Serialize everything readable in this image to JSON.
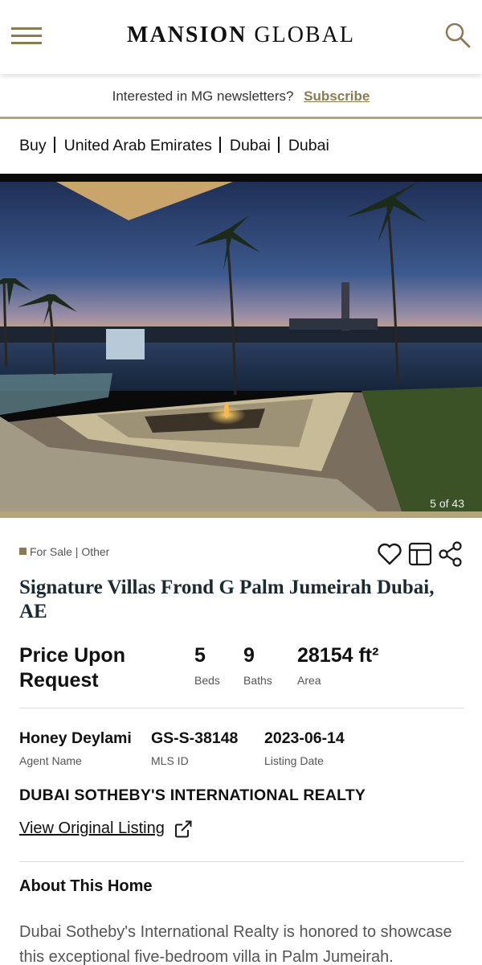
{
  "header": {
    "logo_bold": "MANSION",
    "logo_light": "GLOBAL",
    "menu_icon": "hamburger-menu-icon",
    "search_icon": "search-icon",
    "accent_color": "#8c7b52"
  },
  "newsletter": {
    "text": "Interested in MG newsletters?",
    "link": "Subscribe"
  },
  "breadcrumb": [
    "Buy",
    "United Arab Emirates",
    "Dubai",
    "Dubai"
  ],
  "gallery": {
    "counter": "5 of 43",
    "current": 5,
    "total": 43
  },
  "listing": {
    "status": "For Sale | Other",
    "actions": [
      "heart-icon",
      "layout-icon",
      "share-icon"
    ],
    "title": "Signature Villas Frond G Palm Jumeirah Dubai, AE",
    "price": "Price Upon Request",
    "stats": [
      {
        "value": "5",
        "label": "Beds"
      },
      {
        "value": "9",
        "label": "Baths"
      },
      {
        "value": "28154 ft²",
        "label": "Area"
      }
    ],
    "agent": [
      {
        "value": "Honey Deylami",
        "label": "Agent Name"
      },
      {
        "value": "GS-S-38148",
        "label": "MLS ID"
      },
      {
        "value": "2023-06-14",
        "label": "Listing Date"
      }
    ],
    "brokerage": "DUBAI SOTHEBY'S INTERNATIONAL REALTY",
    "view_link": "View Original Listing",
    "external_icon": "external-link-icon"
  },
  "about": {
    "heading": "About This Home",
    "text": "Dubai Sotheby's International Realty is honored to showcase this exceptional five-bedroom villa in Palm Jumeirah."
  }
}
